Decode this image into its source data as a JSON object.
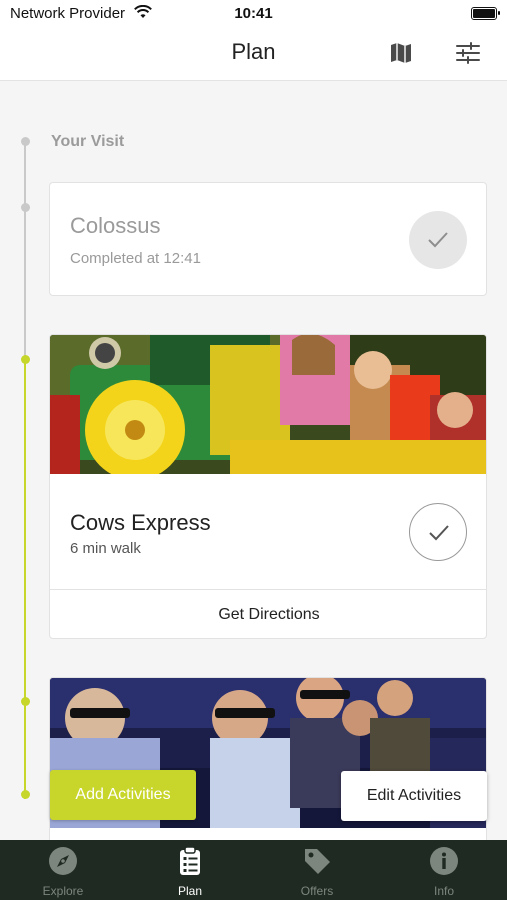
{
  "status": {
    "provider": "Network Provider",
    "time": "10:41"
  },
  "header": {
    "title": "Plan",
    "map_icon": "map-icon",
    "filter_icon": "sliders-icon"
  },
  "timeline": {
    "section_label": "Your Visit",
    "completed": {
      "name": "Colossus",
      "status": "Completed at 12:41"
    },
    "current": {
      "name": "Cows Express",
      "walk": "6 min walk",
      "directions_label": "Get Directions"
    }
  },
  "actions": {
    "add_label": "Add Activities",
    "edit_label": "Edit Activities"
  },
  "tabs": [
    {
      "label": "Explore",
      "icon": "compass-icon"
    },
    {
      "label": "Plan",
      "icon": "clipboard-icon"
    },
    {
      "label": "Offers",
      "icon": "tag-icon"
    },
    {
      "label": "Info",
      "icon": "info-icon"
    }
  ],
  "colors": {
    "accent": "#c8d52a",
    "tab_bar": "#1f2a22",
    "timeline_past": "#c9c9c9"
  }
}
